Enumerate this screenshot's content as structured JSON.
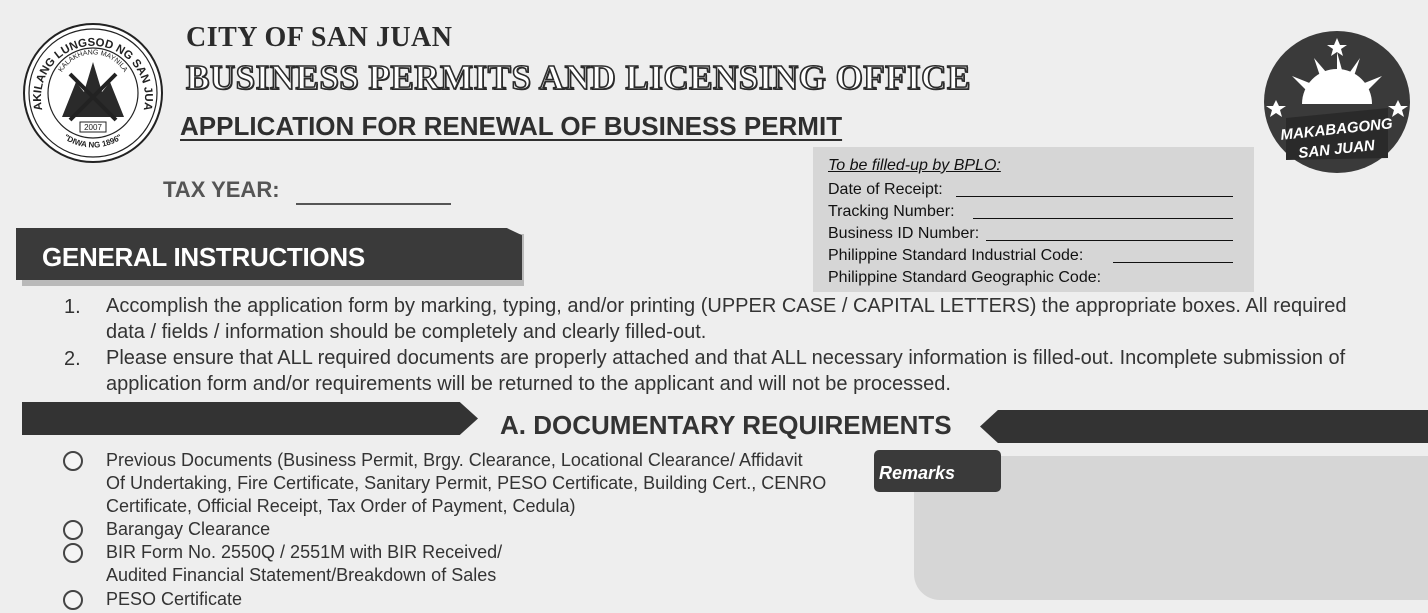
{
  "header": {
    "city": "CITY OF SAN JUAN",
    "office": "BUSINESS PERMITS AND LICENSING OFFICE",
    "form_title": "APPLICATION FOR RENEWAL OF BUSINESS PERMIT",
    "tax_year_label": "TAX YEAR:"
  },
  "seal": {
    "ring_text": "DAKILANG LUNGSOD NG SAN JUAN",
    "inner_text": "KALAKHANG MAYNILA",
    "year": "2007",
    "motto": "\"DIWA NG 1896\""
  },
  "logo": {
    "line1": "MAKABAGONG",
    "line2": "SAN JUAN"
  },
  "bplo": {
    "heading": "To be filled-up by BPLO:",
    "fields": [
      "Date of Receipt:",
      "Tracking Number:",
      "Business ID Number:",
      "Philippine Standard Industrial Code:",
      "Philippine Standard Geographic Code:"
    ]
  },
  "instructions": {
    "title": "GENERAL INSTRUCTIONS",
    "items": [
      {
        "num": "1.",
        "line1": "Accomplish the application form by marking, typing, and/or printing (UPPER CASE / CAPITAL LETTERS) the appropriate boxes. All required",
        "line2": "data / fields / information should be completely and clearly filled-out."
      },
      {
        "num": "2.",
        "line1": "Please ensure that ALL required documents are properly attached and that ALL necessary information is filled-out. Incomplete submission of",
        "line2": "application form and/or requirements will be returned to the applicant and will not be processed."
      }
    ]
  },
  "section_a": {
    "title": "A.  DOCUMENTARY REQUIREMENTS",
    "items": [
      {
        "lines": [
          "Previous Documents (Business Permit, Brgy. Clearance, Locational Clearance/ Affidavit",
          "Of Undertaking, Fire Certificate, Sanitary Permit, PESO Certificate, Building Cert., CENRO",
          "Certificate, Official Receipt, Tax Order of Payment, Cedula)"
        ]
      },
      {
        "lines": [
          "Barangay Clearance"
        ]
      },
      {
        "lines": [
          "BIR Form No. 2550Q / 2551M with BIR Received/",
          "Audited Financial Statement/Breakdown of Sales"
        ]
      },
      {
        "lines": [
          "PESO Certificate"
        ]
      }
    ],
    "remarks_label": "Remarks"
  }
}
